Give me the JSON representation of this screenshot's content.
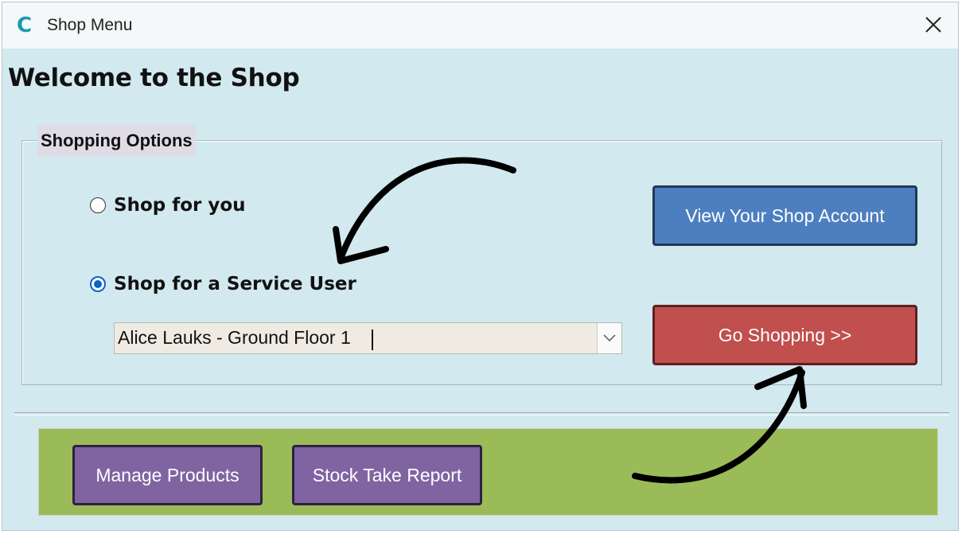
{
  "window": {
    "title": "Shop Menu",
    "app_icon_glyph": "C",
    "icons": {
      "app": "access-app-icon",
      "close": "close-icon"
    }
  },
  "form": {
    "heading": "Welcome to the Shop",
    "shopping_options": {
      "legend": "Shopping Options",
      "radio_shop_for_you": {
        "label": "Shop for you",
        "checked": false
      },
      "radio_service_user": {
        "label": "Shop for a Service User",
        "checked": true
      },
      "service_user_select": {
        "value": "Alice Lauks - Ground Floor 1"
      }
    },
    "buttons": {
      "view_account": "View Your Shop Account",
      "go_shopping": "Go Shopping >>"
    },
    "footer": {
      "manage_products": "Manage Products",
      "stock_take_report": "Stock Take Report"
    }
  },
  "colors": {
    "form_background": "#d2e9ef",
    "account_button": "#4d7fc0",
    "shopping_button": "#c04f4e",
    "footer_bar": "#9bbb59",
    "footer_buttons": "#8064a2",
    "radio_selected": "#0a64c8"
  }
}
